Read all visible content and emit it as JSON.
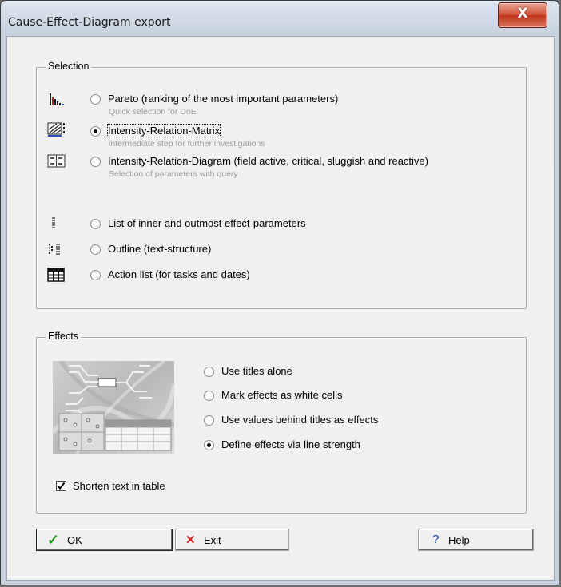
{
  "window": {
    "title": "Cause-Effect-Diagram export",
    "close_glyph": "X"
  },
  "selection": {
    "group_label": "Selection",
    "options": [
      {
        "icon": "pareto-chart-icon",
        "label": "Pareto (ranking of the most important parameters)",
        "sub": "Quick selection for DoE",
        "selected": false
      },
      {
        "icon": "matrix-icon",
        "label": "Intensity-Relation-Matrix",
        "sub": "intermediate step for further investigations",
        "selected": true
      },
      {
        "icon": "relation-diagram-icon",
        "label": "Intensity-Relation-Diagram (field active, critical, sluggish and reactive)",
        "sub": "Selection of parameters with query",
        "selected": false
      },
      {
        "icon": "list-icon",
        "label": "List of inner and outmost effect-parameters",
        "sub": "",
        "selected": false
      },
      {
        "icon": "outline-icon",
        "label": "Outline (text-structure)",
        "sub": "",
        "selected": false
      },
      {
        "icon": "table-icon",
        "label": "Action list (for tasks and dates)",
        "sub": "",
        "selected": false
      }
    ]
  },
  "effects": {
    "group_label": "Effects",
    "options": [
      {
        "label": "Use titles alone",
        "selected": false
      },
      {
        "label": "Mark effects as white cells",
        "selected": false
      },
      {
        "label": "Use values behind titles as effects",
        "selected": false
      },
      {
        "label": "Define effects via line strength",
        "selected": true
      }
    ],
    "shorten_label": "Shorten text in table",
    "shorten_checked": true
  },
  "buttons": {
    "ok": {
      "label": "OK",
      "icon": "checkmark-icon",
      "glyph": "✓",
      "color": "#1a9a1a"
    },
    "exit": {
      "label": "Exit",
      "icon": "cross-icon",
      "glyph": "✕",
      "color": "#d42020"
    },
    "help": {
      "label": "Help",
      "icon": "question-icon",
      "glyph": "?",
      "color": "#1a3fa8"
    }
  }
}
